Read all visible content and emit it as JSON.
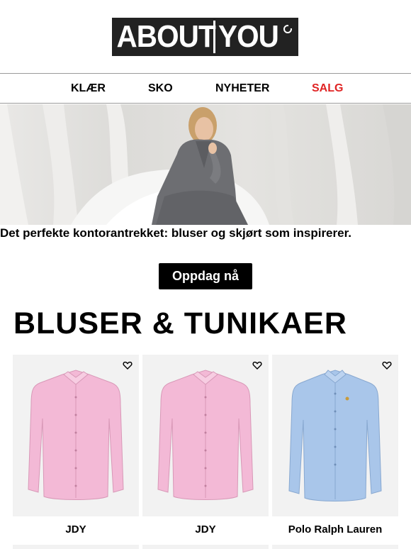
{
  "brand": {
    "logo_left": "ABOUT",
    "logo_right": "YOU"
  },
  "nav": {
    "items": [
      {
        "label": "KLÆR"
      },
      {
        "label": "SKO"
      },
      {
        "label": "NYHETER"
      },
      {
        "label": "SALG"
      }
    ],
    "sale_color": "#e02424"
  },
  "hero": {
    "caption": "Det perfekte kontorantrekket: bluser og skjørt som inspirerer.",
    "cta_label": "Oppdag nå"
  },
  "section": {
    "title": "BLUSER & TUNIKAER",
    "products": [
      {
        "brand": "JDY",
        "color": "#f3b9d6"
      },
      {
        "brand": "JDY",
        "color": "#f3b9d6"
      },
      {
        "brand": "Polo Ralph Lauren",
        "color": "#a9c6ea"
      }
    ]
  }
}
